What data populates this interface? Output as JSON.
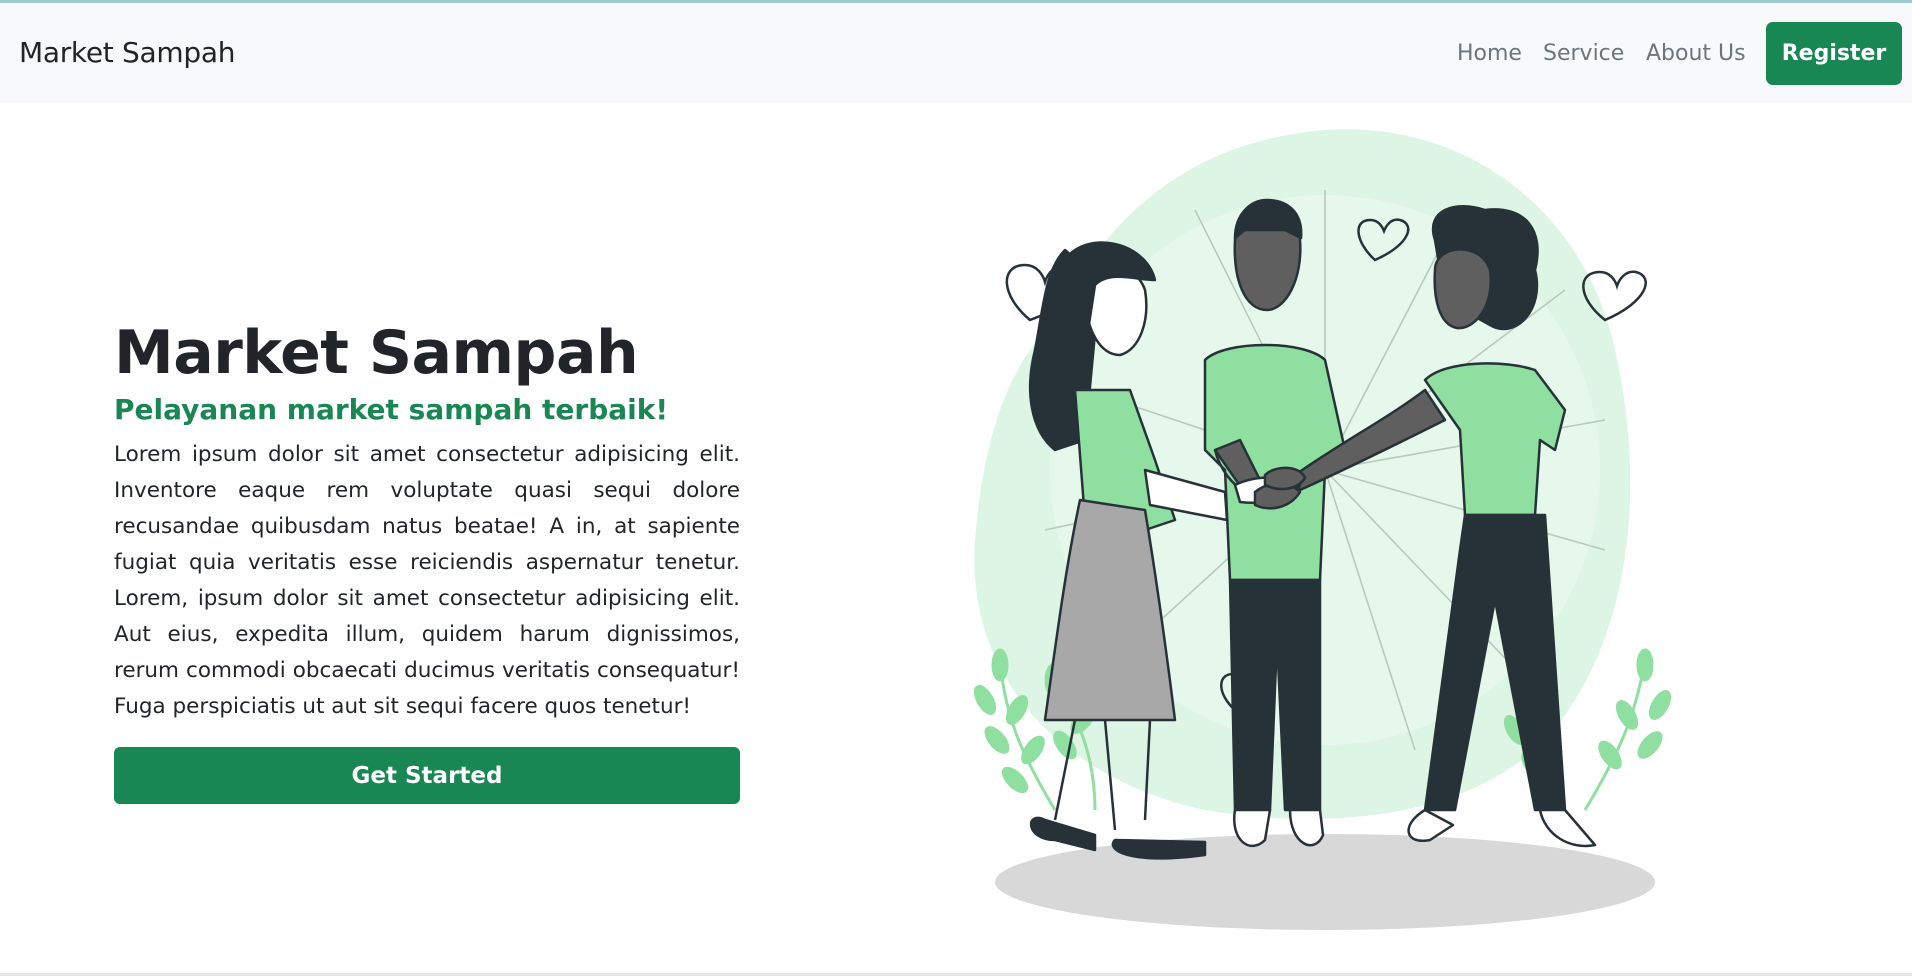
{
  "navbar": {
    "brand": "Market Sampah",
    "links": [
      "Home",
      "Service",
      "About Us"
    ],
    "register_label": "Register"
  },
  "hero": {
    "title": "Market Sampah",
    "subtitle": "Pelayanan market sampah terbaik!",
    "body": "Lorem ipsum dolor sit amet consectetur adipisicing elit. Inventore eaque rem voluptate quasi sequi dolore recusandae quibusdam natus beatae! A in, at sapiente fugiat quia veritatis esse reiciendis aspernatur tenetur. Lorem, ipsum dolor sit amet consectetur adipisicing elit. Aut eius, expedita illum, quidem harum dignissimos, rerum commodi obcaecati ducimus veritatis consequatur! Fuga perspiciatis ut aut sit sequi facere quos tenetur!",
    "cta_label": "Get Started"
  },
  "illustration": {
    "icon": "team-hands-together-illustration",
    "colors": {
      "accent": "#198754",
      "light_green": "#8fe0a0",
      "pale_green": "#ddf5e4",
      "dark": "#263238",
      "gray": "#a8a8a8"
    }
  }
}
